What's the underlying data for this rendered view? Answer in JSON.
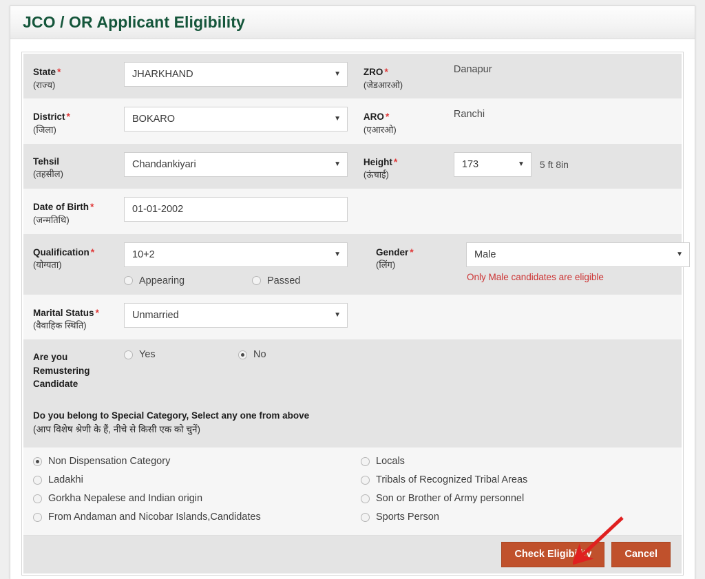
{
  "header": {
    "title": "JCO / OR Applicant Eligibility"
  },
  "fields": {
    "state": {
      "label": "State",
      "hindi": "(राज्य)",
      "required": true,
      "value": "JHARKHAND"
    },
    "zro": {
      "label": "ZRO",
      "hindi": "(जेडआरओ)",
      "required": true,
      "value": "Danapur"
    },
    "district": {
      "label": "District",
      "hindi": "(जिला)",
      "required": true,
      "value": "BOKARO"
    },
    "aro": {
      "label": "ARO",
      "hindi": "(एआरओ)",
      "required": true,
      "value": "Ranchi"
    },
    "tehsil": {
      "label": "Tehsil",
      "hindi": "(तहसील)",
      "required": false,
      "value": "Chandankiyari"
    },
    "height": {
      "label": "Height",
      "hindi": "(ऊंचाई)",
      "required": true,
      "value": "173",
      "unit_text": "5 ft 8in"
    },
    "dob": {
      "label": "Date of Birth",
      "hindi": "(जन्मतिथि)",
      "required": true,
      "value": "01-01-2002"
    },
    "qualification": {
      "label": "Qualification",
      "hindi": "(योग्यता)",
      "required": true,
      "value": "10+2",
      "options": [
        {
          "label": "Appearing",
          "selected": false
        },
        {
          "label": "Passed",
          "selected": false
        }
      ]
    },
    "gender": {
      "label": "Gender",
      "hindi": "(लिंग)",
      "required": true,
      "value": "Male",
      "note": "Only Male candidates are eligible"
    },
    "marital": {
      "label": "Marital Status",
      "hindi": "(वैवाहिक स्थिति)",
      "required": true,
      "value": "Unmarried"
    },
    "remustering": {
      "label_line1": "Are you Remustering",
      "label_line2": "Candidate",
      "required": true,
      "options": [
        {
          "label": "Yes",
          "selected": false
        },
        {
          "label": "No",
          "selected": true
        }
      ]
    }
  },
  "special_category": {
    "heading_en": "Do you belong to Special Category, Select any one from above",
    "heading_hi": "(आप विशेष श्रेणी के हैं, नीचे से किसी एक को चुनें)",
    "left_options": [
      {
        "label": "Non Dispensation Category",
        "selected": true
      },
      {
        "label": "Ladakhi",
        "selected": false
      },
      {
        "label": "Gorkha Nepalese and Indian origin",
        "selected": false
      },
      {
        "label": "From Andaman and Nicobar Islands,Candidates",
        "selected": false
      }
    ],
    "right_options": [
      {
        "label": "Locals",
        "selected": false
      },
      {
        "label": "Tribals of Recognized Tribal Areas",
        "selected": false
      },
      {
        "label": "Son or Brother of Army personnel",
        "selected": false
      },
      {
        "label": "Sports Person",
        "selected": false
      }
    ]
  },
  "footer": {
    "check_label": "Check Eligibility",
    "cancel_label": "Cancel"
  },
  "colors": {
    "title_green": "#15563b",
    "required_red": "#e03a3a",
    "warn_red": "#cc3333",
    "button_orange": "#c0512c",
    "annotation_red": "#e02020"
  },
  "annotation": {
    "type": "arrow",
    "points_to": "check-eligibility-button"
  }
}
